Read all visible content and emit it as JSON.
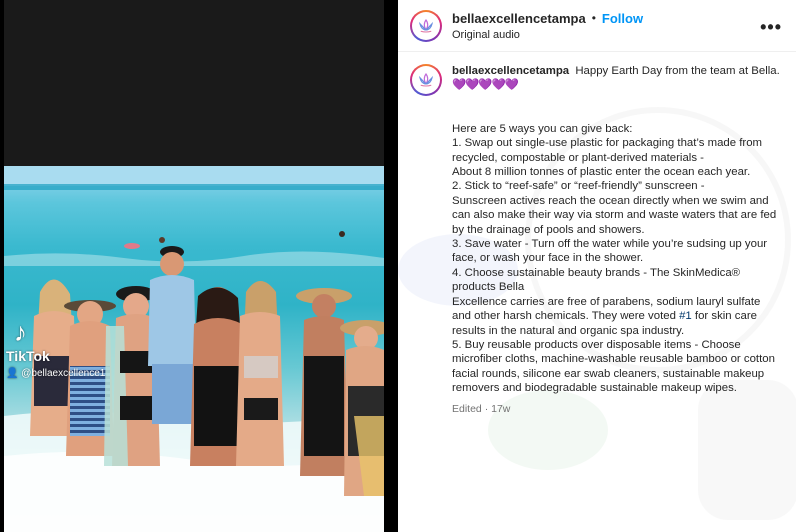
{
  "post": {
    "username": "bellaexcellencetampa",
    "follow_label": "Follow",
    "separator": "•",
    "audio_label": "Original audio",
    "more_label": "•••"
  },
  "video": {
    "overlay_logo": "♪",
    "overlay_brand": "TikTok",
    "overlay_handle": "👤 @bellaexcellence1"
  },
  "caption": {
    "username": "bellaexcellencetampa",
    "intro": "Happy Earth Day from the team at Bella.",
    "hearts": "💜💜💜💜💜",
    "lines": [
      "Here are 5 ways you can give back:",
      "1. Swap out single-use plastic for packaging that’s made from recycled, compostable or plant-derived materials -",
      "About 8 million tonnes of plastic enter the ocean each year.",
      "2. Stick to “reef-safe” or “reef-friendly” sunscreen -",
      "Sunscreen actives reach the ocean directly when we swim and can also make their way via storm and waste waters that are fed by the drainage of pools and showers.",
      "3. Save water - Turn off the water while you’re sudsing up your face, or wash your face in the shower.",
      "4. Choose sustainable beauty brands - The SkinMedica® products Bella",
      "Excellence carries are free of parabens, sodium lauryl sulfate and other harsh chemicals. They were voted ",
      "#1",
      " for skin care results in the natural and organic spa industry.",
      "5. Buy reusable products over disposable items - Choose microfiber cloths, machine-washable reusable bamboo or cotton facial rounds, silicone ear swab cleaners, sustainable makeup removers and biodegradable sustainable makeup wipes."
    ],
    "meta": "Edited · 17w"
  },
  "colors": {
    "link": "#0095f6",
    "hashtag": "#00376b",
    "secondary_text": "#737373",
    "hearts": "#c43ce6"
  }
}
